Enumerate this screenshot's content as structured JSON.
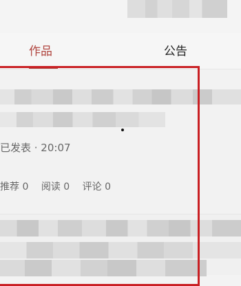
{
  "tabs": [
    {
      "label": "作品",
      "active": true
    },
    {
      "label": "公告",
      "active": false
    }
  ],
  "post": {
    "meta": "已发表 · 20:07",
    "stats": {
      "recommend_label": "推荐",
      "recommend_count": "0",
      "read_label": "阅读",
      "read_count": "0",
      "comment_label": "评论",
      "comment_count": "0"
    }
  },
  "colors": {
    "active_tab": "#b0453f",
    "highlight_border": "#c91f23"
  }
}
